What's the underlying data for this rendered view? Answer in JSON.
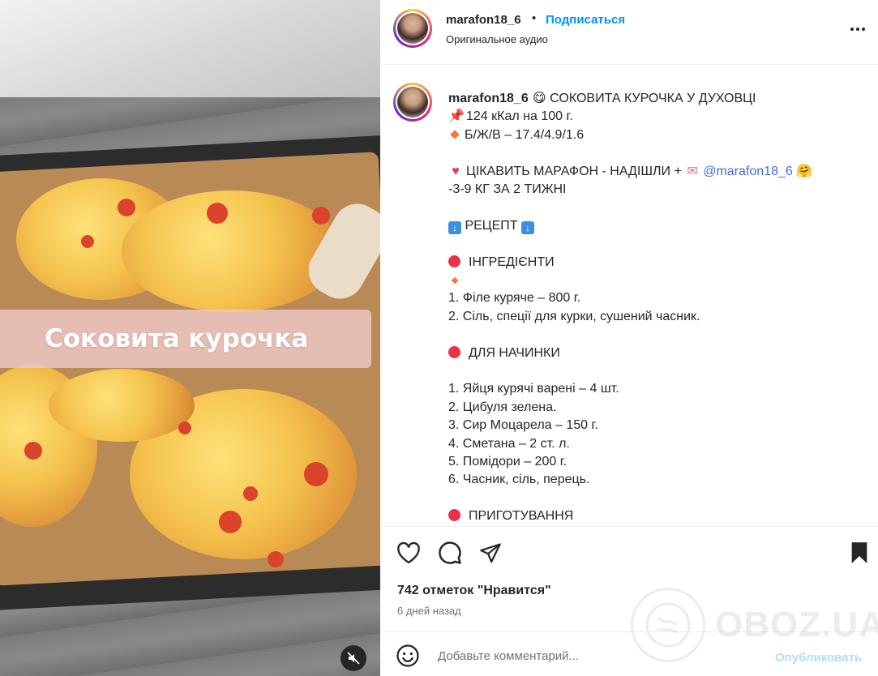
{
  "media": {
    "overlay_text": "Соковита курочка",
    "mute_icon": "speaker-muted-icon"
  },
  "header": {
    "username": "marafon18_6",
    "separator": "•",
    "follow_label": "Подписаться",
    "audio_label": "Оригинальное аудио",
    "more_icon": "more-options-icon"
  },
  "caption": {
    "username": "marafon18_6",
    "title": "СОКОВИТА КУРОЧКА У ДУХОВЦІ",
    "calories": "124 кКал на 100 г.",
    "macros": "Б/Ж/В – 17.4/4.9/1.6",
    "marathon_text": "ЦІКАВИТЬ МАРАФОН - НАДІШЛИ +",
    "mention": "@marafon18_6",
    "marathon_sub": "-3-9 КГ ЗА 2 ТИЖНІ",
    "recipe_heading": "РЕЦЕПТ",
    "ingredients_heading": "ІНГРЕДІЄНТИ",
    "ingredients": [
      "1. Філе куряче – 800 г.",
      "2. Сіль, спеції для курки, сушений часник."
    ],
    "filling_heading": "ДЛЯ НАЧИНКИ",
    "filling": [
      "1. Яйця курячі варені – 4 шт.",
      "2. Цибуля зелена.",
      "3. Сир Моцарела – 150 г.",
      "4. Сметана – 2 ст. л.",
      "5. Помідори – 200 г.",
      "6. Часник, сіль, перець."
    ],
    "cooking_heading": "ПРИГОТУВАННЯ"
  },
  "actions": {
    "likes": "742 отметок \"Нравится\"",
    "time_ago": "6 дней назад"
  },
  "comment": {
    "placeholder": "Добавьте комментарий...",
    "post_label": "Опубликовать"
  },
  "watermark": {
    "text": "OBOZ.UA"
  },
  "colors": {
    "accent": "#0095f6",
    "mention": "#3f6fd8",
    "post_disabled": "#b3dbff",
    "muted_text": "#737373"
  }
}
